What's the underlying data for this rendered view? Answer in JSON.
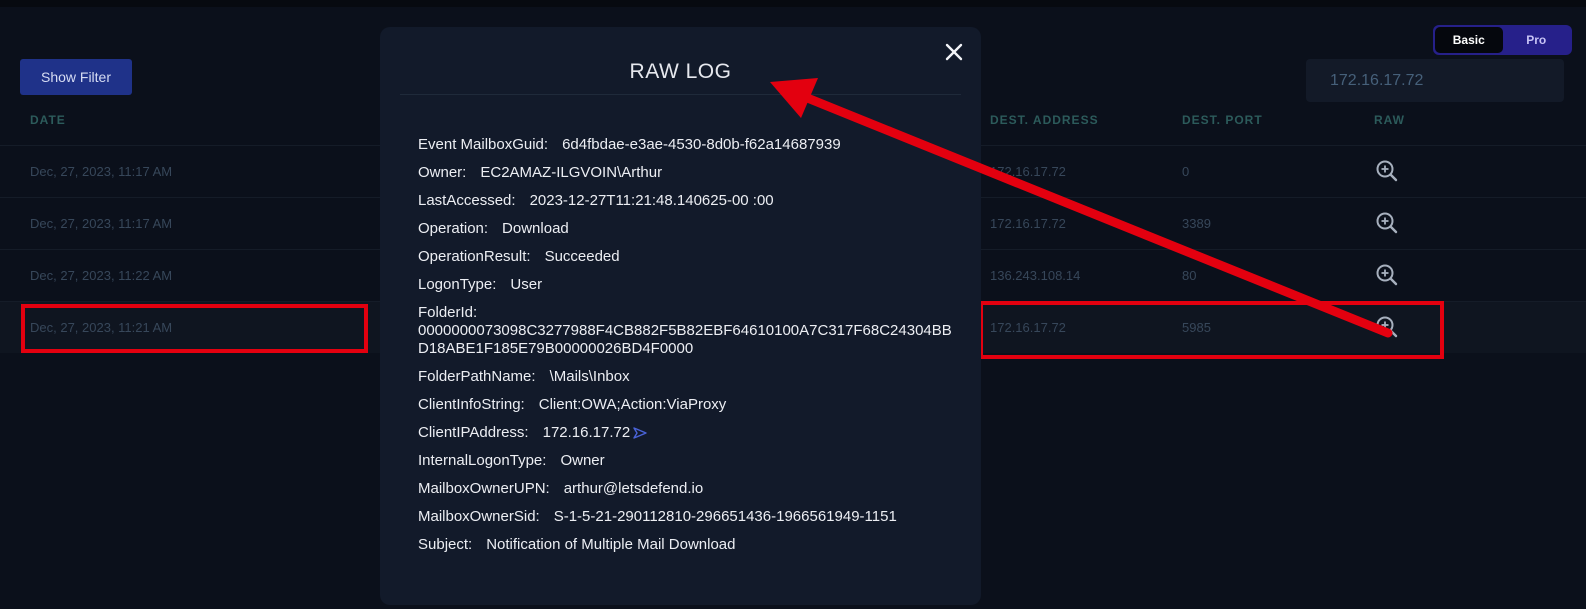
{
  "toolbar": {
    "show_filter": "Show Filter",
    "toggle": {
      "basic": "Basic",
      "pro": "Pro"
    },
    "search_value": "172.16.17.72"
  },
  "table": {
    "headers": {
      "date": "DATE",
      "dest_address": "DEST. ADDRESS",
      "dest_port": "DEST. PORT",
      "raw": "RAW"
    },
    "rows": [
      {
        "date": "Dec, 27, 2023, 11:17 AM",
        "dest_address": "172.16.17.72",
        "dest_port": "0"
      },
      {
        "date": "Dec, 27, 2023, 11:17 AM",
        "dest_address": "172.16.17.72",
        "dest_port": "3389"
      },
      {
        "date": "Dec, 27, 2023, 11:22 AM",
        "dest_address": "136.243.108.14",
        "dest_port": "80"
      },
      {
        "date": "Dec, 27, 2023, 11:21 AM",
        "dest_address": "172.16.17.72",
        "dest_port": "5985"
      }
    ]
  },
  "modal": {
    "title": "RAW LOG",
    "fields": [
      {
        "key": "Event MailboxGuid:",
        "value": "6d4fbdae-e3ae-4530-8d0b-f62a14687939"
      },
      {
        "key": "Owner:",
        "value": "EC2AMAZ-ILGVOIN\\Arthur"
      },
      {
        "key": "LastAccessed:",
        "value": "2023-12-27T11:21:48.140625-00  :00"
      },
      {
        "key": "Operation:",
        "value": "Download"
      },
      {
        "key": "OperationResult:",
        "value": "Succeeded"
      },
      {
        "key": "LogonType:",
        "value": "User"
      },
      {
        "key": "FolderId:",
        "value": "0000000073098C3277988F4CB882F5B82EBF64610100A7C317F68C24304BBD18ABE1F185E79B00000026BD4F0000"
      },
      {
        "key": "FolderPathName:",
        "value": "\\Mails\\Inbox"
      },
      {
        "key": "ClientInfoString:",
        "value": "Client:OWA;Action:ViaProxy"
      },
      {
        "key": "ClientIPAddress:",
        "value": "172.16.17.72"
      },
      {
        "key": "InternalLogonType:",
        "value": "Owner"
      },
      {
        "key": "MailboxOwnerUPN:",
        "value": "arthur@letsdefend.io"
      },
      {
        "key": "MailboxOwnerSid:",
        "value": "S-1-5-21-290112810-296651436-1966561949-1151"
      },
      {
        "key": "Subject:",
        "value": "Notification of Multiple Mail Download"
      }
    ]
  },
  "icons": {
    "close": "close-icon",
    "zoom": "zoom-in-icon",
    "send": "send-icon"
  },
  "colors": {
    "accent": "#1f3289",
    "annotation": "#e3000f",
    "modal_bg": "#121a2a",
    "page_bg": "#0b101b"
  }
}
